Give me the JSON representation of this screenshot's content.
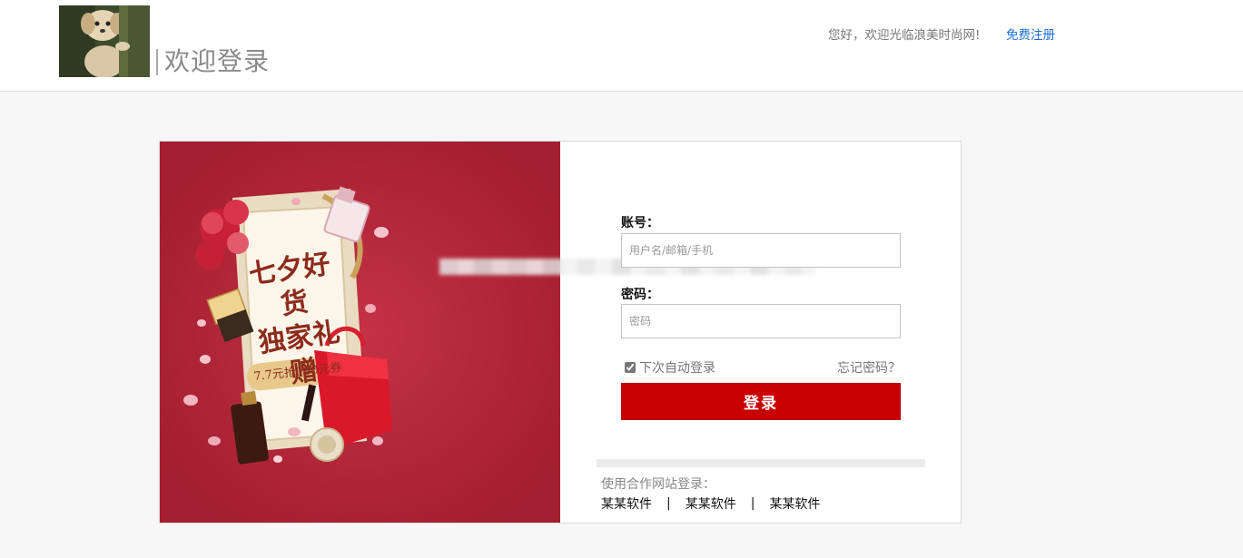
{
  "header": {
    "logo_icon": "puppy-photo",
    "title": "欢迎登录",
    "greeting": "您好，欢迎光临浪美时尚网!",
    "register_link": "免费注册"
  },
  "banner": {
    "background": "#a31e30",
    "title_line1": "七夕好货",
    "title_line2": "独家礼赠",
    "coupon": "7.7元抢100元券"
  },
  "form": {
    "account_label": "账号：",
    "account_placeholder": "用户名/邮箱/手机",
    "password_label": "密码：",
    "password_placeholder": "密码",
    "remember_label": "下次自动登录",
    "remember_checked": true,
    "forgot_link": "忘记密码？",
    "login_button": "登录",
    "login_button_color": "#c90000",
    "partner_title": "使用合作网站登录：",
    "partners": [
      "某某软件",
      "某某软件",
      "某某软件"
    ],
    "partner_separator": "|"
  },
  "colors": {
    "link_blue": "#1a6fd6",
    "page_background": "#f7f7f7"
  }
}
